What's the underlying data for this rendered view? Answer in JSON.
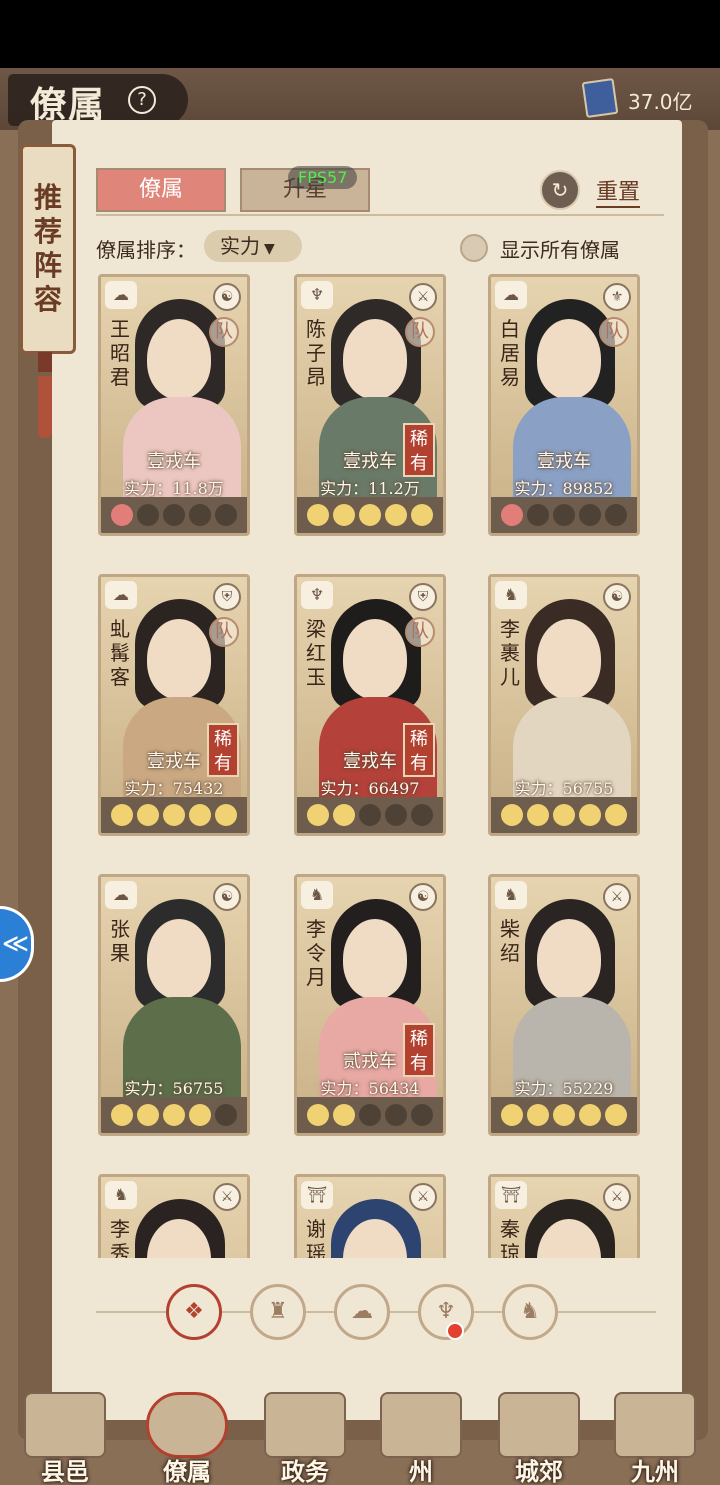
{
  "header": {
    "title": "僚属",
    "help_icon": "?",
    "currency_value": "37.0亿"
  },
  "side_tag": {
    "chars": [
      "推",
      "荐",
      "阵",
      "容"
    ]
  },
  "tabs": [
    {
      "label": "僚属",
      "active": true
    },
    {
      "label": "升星",
      "active": false
    }
  ],
  "fps": "FPS57",
  "reset_label": "重置",
  "sort": {
    "label": "僚属排序：",
    "value": "实力",
    "arrow": "▼"
  },
  "show_all_label": "显示所有僚属",
  "cards": [
    {
      "name": "王昭君",
      "rank": "壹戎车",
      "power": "实力：11.8万",
      "team": "队",
      "rare": "",
      "moons": [
        1,
        0,
        0,
        0,
        0
      ],
      "moon_style": "red",
      "faction": "☁",
      "type": "☯",
      "hair": "#2e2826",
      "cloth": "#ecc7c1"
    },
    {
      "name": "陈子昂",
      "rank": "壹戎车",
      "power": "实力：11.2万",
      "team": "队",
      "rare": "稀有",
      "moons": [
        1,
        1,
        1,
        1,
        1
      ],
      "moon_style": "gold",
      "faction": "♆",
      "type": "⚔",
      "hair": "#2f2a27",
      "cloth": "#6a7a68"
    },
    {
      "name": "白居易",
      "rank": "壹戎车",
      "power": "实力：89852",
      "team": "队",
      "rare": "",
      "moons": [
        1,
        0,
        0,
        0,
        0
      ],
      "moon_style": "red",
      "faction": "☁",
      "type": "⚜",
      "hair": "#222",
      "cloth": "#8aa0c4"
    },
    {
      "name": "虬髯客",
      "rank": "壹戎车",
      "power": "实力：75432",
      "team": "队",
      "rare": "稀有",
      "moons": [
        1,
        1,
        1,
        1,
        1
      ],
      "moon_style": "gold",
      "faction": "☁",
      "type": "⛨",
      "hair": "#2b2420",
      "cloth": "#c9a882"
    },
    {
      "name": "梁红玉",
      "rank": "壹戎车",
      "power": "实力：66497",
      "team": "队",
      "rare": "稀有",
      "moons": [
        1,
        1,
        0,
        0,
        0
      ],
      "moon_style": "gold",
      "faction": "♆",
      "type": "⛨",
      "hair": "#1f1c1c",
      "cloth": "#b4413a"
    },
    {
      "name": "李裹儿",
      "rank": "",
      "power": "实力：56755",
      "team": "",
      "rare": "",
      "moons": [
        1,
        1,
        1,
        1,
        1
      ],
      "moon_style": "gold",
      "faction": "♞",
      "type": "☯",
      "hair": "#3a2b24",
      "cloth": "#e3d6c0"
    },
    {
      "name": "张果",
      "rank": "",
      "power": "实力：56755",
      "team": "",
      "rare": "",
      "moons": [
        1,
        1,
        1,
        1,
        0
      ],
      "moon_style": "gold",
      "faction": "☁",
      "type": "☯",
      "hair": "#2c2c2c",
      "cloth": "#5c6e4a"
    },
    {
      "name": "李令月",
      "rank": "贰戎车",
      "power": "实力：56434",
      "team": "",
      "rare": "稀有",
      "moons": [
        1,
        1,
        0,
        0,
        0
      ],
      "moon_style": "gold",
      "faction": "♞",
      "type": "☯",
      "hair": "#241f1f",
      "cloth": "#e8a8a3"
    },
    {
      "name": "柴绍",
      "rank": "",
      "power": "实力：55229",
      "team": "",
      "rare": "",
      "moons": [
        1,
        1,
        1,
        1,
        1
      ],
      "moon_style": "gold",
      "faction": "♞",
      "type": "⚔",
      "hair": "#2a2522",
      "cloth": "#b9b5ac"
    },
    {
      "name": "李秀",
      "rank": "",
      "power": "",
      "team": "",
      "rare": "",
      "moons": [
        0,
        0,
        0,
        0,
        0
      ],
      "moon_style": "gold",
      "faction": "♞",
      "type": "⚔",
      "hair": "#2b2321",
      "cloth": "#c4a987"
    },
    {
      "name": "谢瑶",
      "rank": "",
      "power": "",
      "team": "",
      "rare": "",
      "moons": [
        0,
        0,
        0,
        0,
        0
      ],
      "moon_style": "gold",
      "faction": "⛩",
      "type": "⚔",
      "hair": "#2e4470",
      "cloth": "#c4a987"
    },
    {
      "name": "秦琼",
      "rank": "",
      "power": "",
      "team": "",
      "rare": "",
      "moons": [
        0,
        0,
        0,
        0,
        0
      ],
      "moon_style": "gold",
      "faction": "⛩",
      "type": "⚔",
      "hair": "#2a2421",
      "cloth": "#c4a987"
    }
  ],
  "pager": [
    "❖",
    "♜",
    "☁",
    "♆",
    "♞"
  ],
  "side_float_icon": "≪",
  "nav": [
    {
      "label": "县邑",
      "active": false
    },
    {
      "label": "僚属",
      "active": true
    },
    {
      "label": "政务",
      "active": false
    },
    {
      "label": "州",
      "active": false
    },
    {
      "label": "城郊",
      "active": false
    },
    {
      "label": "九州",
      "active": false
    }
  ],
  "colors": {
    "accent": "#b3412f",
    "tab_active": "#e08579",
    "moon_gold": "#f0d273",
    "moon_red": "#e27e7a"
  }
}
